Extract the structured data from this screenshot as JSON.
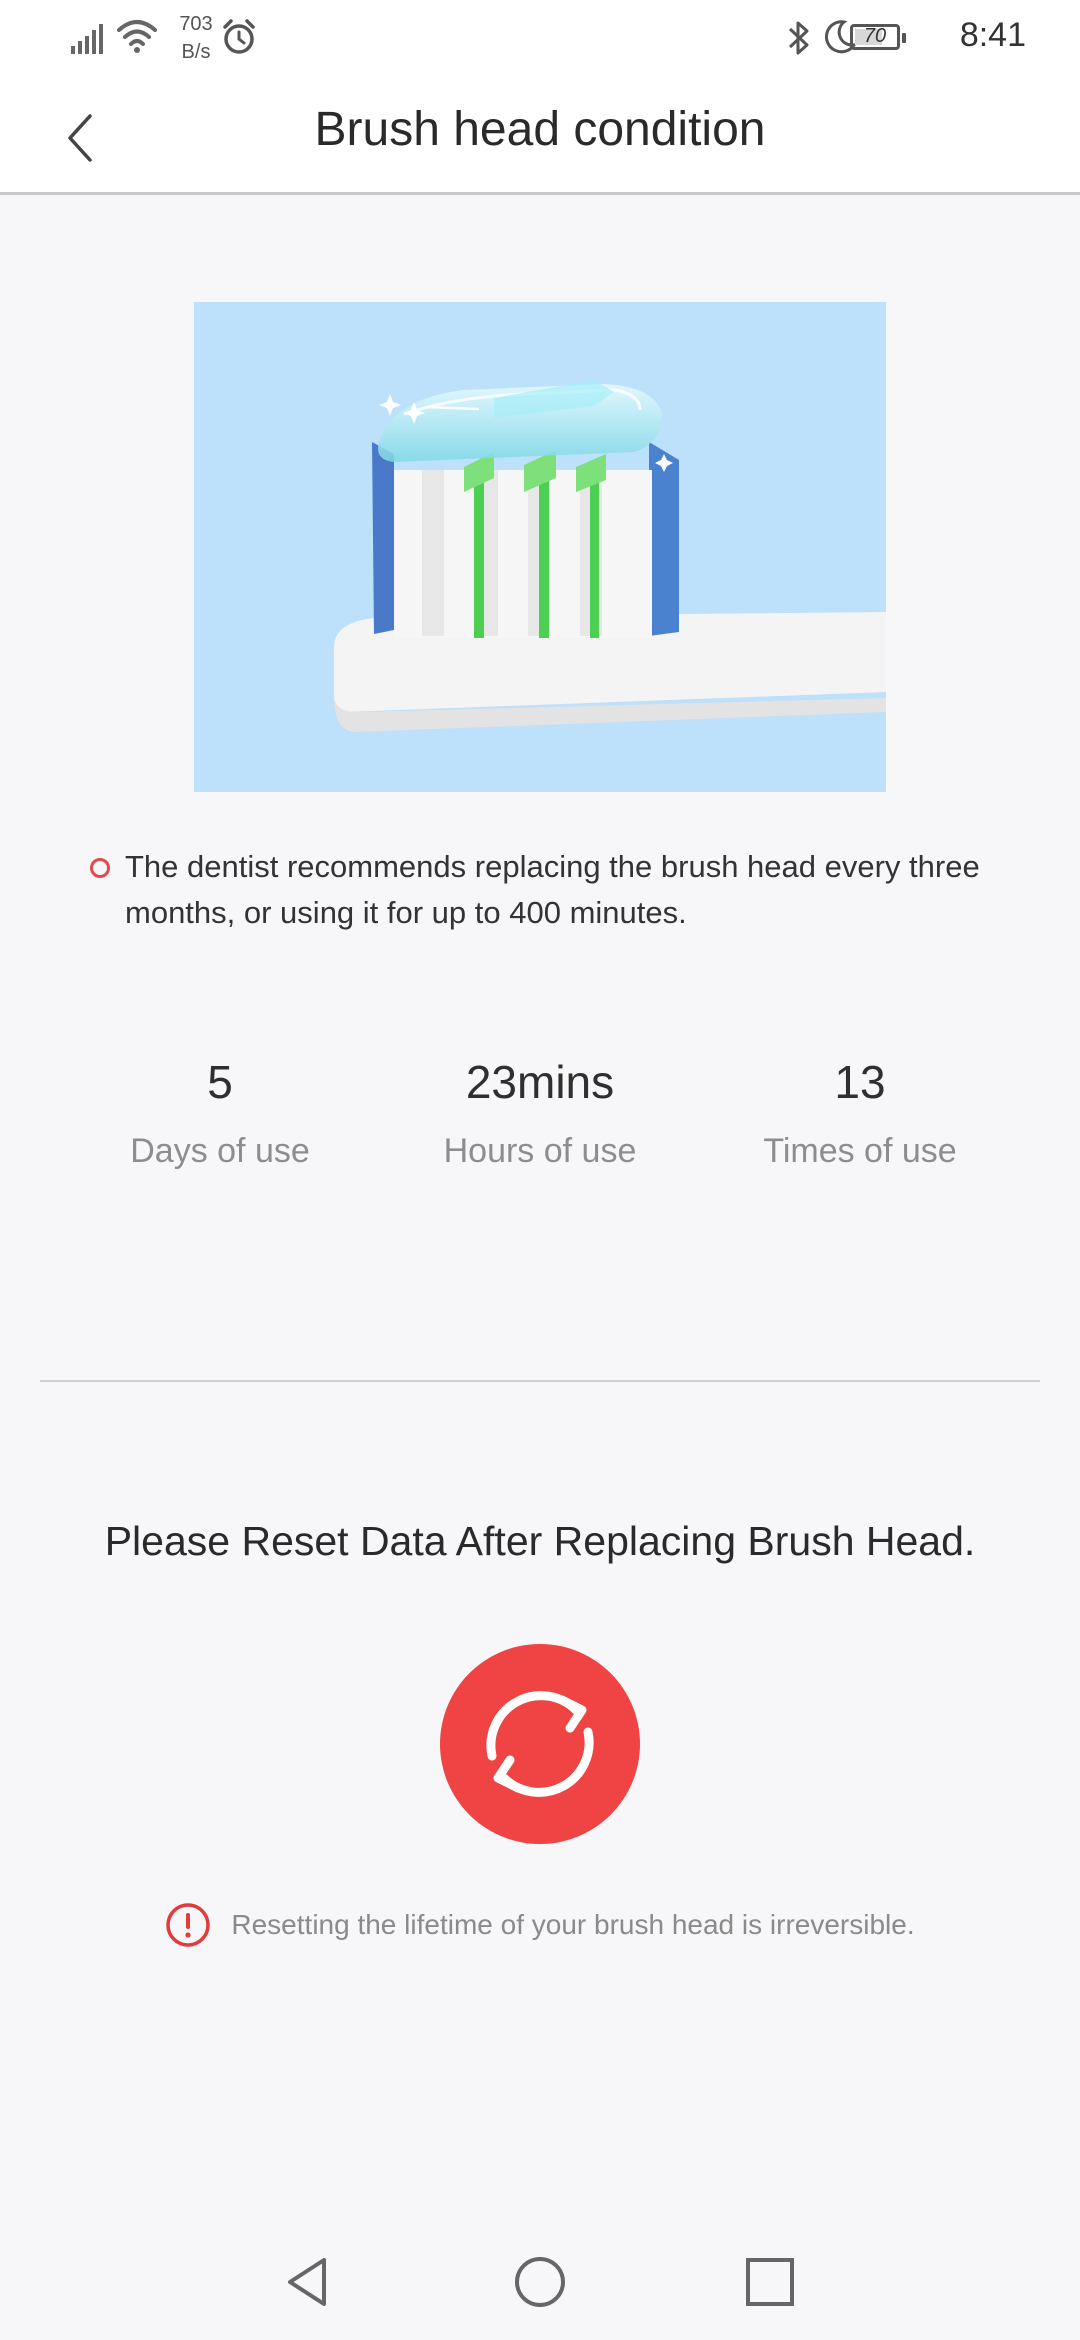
{
  "status_bar": {
    "net_speed_value": "703",
    "net_speed_unit": "B/s",
    "battery_level": "70",
    "battery_fraction": 0.7,
    "time": "8:41"
  },
  "header": {
    "title": "Brush head condition"
  },
  "note": {
    "text": "The dentist recommends replacing the brush head every three months, or using it for up to 400 minutes."
  },
  "stats": [
    {
      "value": "5",
      "label": "Days of use"
    },
    {
      "value": "23mins",
      "label": "Hours of use"
    },
    {
      "value": "13",
      "label": "Times of use"
    }
  ],
  "reset": {
    "title": "Please Reset Data After Replacing Brush Head.",
    "warning": "Resetting the lifetime of your brush head is irreversible."
  },
  "colors": {
    "accent": "#f04444",
    "illustration_bg": "#bde0fb",
    "page_bg": "#f7f7f9"
  },
  "icons": {
    "back": "chevron-left-icon",
    "reset": "refresh-icon",
    "warning": "exclamation-circle-icon",
    "nav_back": "triangle-back-icon",
    "nav_home": "circle-home-icon",
    "nav_recents": "square-recents-icon"
  }
}
